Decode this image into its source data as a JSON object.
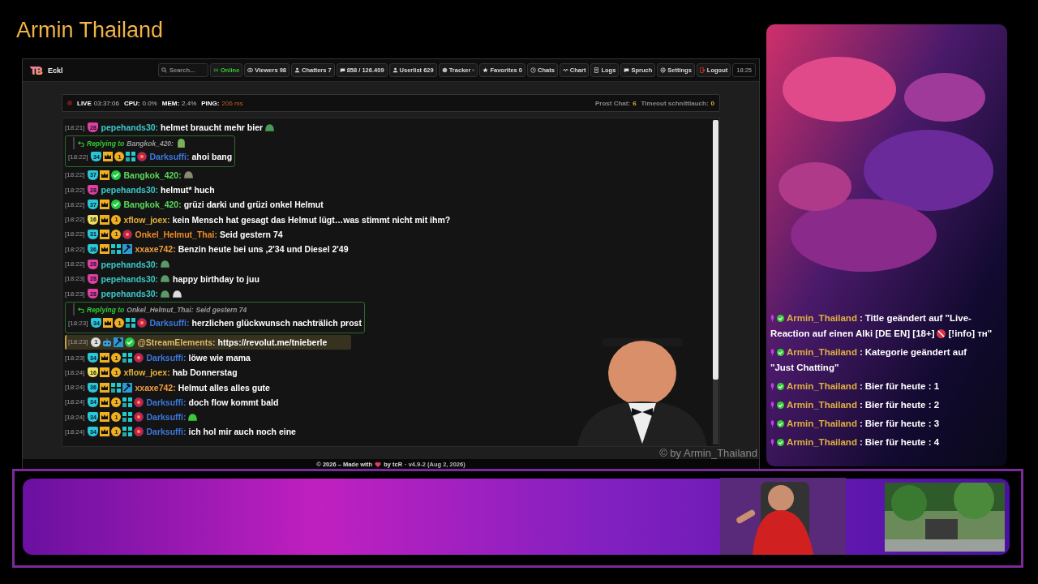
{
  "stream_title": "Armin Thailand",
  "app": {
    "logo": "TB",
    "channel": "Eckl",
    "search": {
      "placeholder": "Search..."
    },
    "nav": [
      {
        "kind": "online",
        "label": "Online"
      },
      {
        "kind": "viewers",
        "label": "Viewers 98"
      },
      {
        "kind": "chatters",
        "label": "Chatters 7"
      },
      {
        "kind": "messages",
        "label": "858 / 126.409"
      },
      {
        "kind": "userlist",
        "label": "Userlist 629"
      },
      {
        "kind": "tracker",
        "label": "Tracker"
      },
      {
        "kind": "favorites",
        "label": "Favorites 0"
      },
      {
        "kind": "chats",
        "label": "Chats"
      },
      {
        "kind": "chart",
        "label": "Chart"
      },
      {
        "kind": "logs",
        "label": "Logs"
      },
      {
        "kind": "spruch",
        "label": "Spruch"
      },
      {
        "kind": "settings",
        "label": "Settings"
      },
      {
        "kind": "logout",
        "label": "Logout"
      }
    ],
    "clock": "18:25",
    "status": {
      "live": "LIVE",
      "uptime": "03:37:06",
      "cpu_label": "CPU:",
      "cpu": "0.0%",
      "mem_label": "MEM:",
      "mem": "2.4%",
      "ping_label": "PING:",
      "ping": "206 ms",
      "prost_label": "Prost Chat:",
      "prost": "6",
      "timeout_label": "Timeout schnittlauch:",
      "timeout": "0"
    },
    "messages": [
      {
        "kind": "normal",
        "time": "[18:21]",
        "badges": [
          {
            "kind": "sub",
            "label": "28",
            "color": "#e040a0"
          }
        ],
        "user": "pepehands30:",
        "color": "#3cc8c8",
        "parts": [
          {
            "kind": "text",
            "text": "helmet braucht mehr bier"
          },
          {
            "kind": "emote",
            "color": "#4a9a5a"
          }
        ]
      },
      {
        "kind": "reply",
        "reply": {
          "label": "Replying to",
          "user": "Bangkok_420:",
          "parts": [
            {
              "kind": "emote",
              "color": "#7ab05a"
            }
          ]
        },
        "time": "[18:22]",
        "badges": [
          {
            "kind": "sub",
            "label": "34",
            "color": "#28c8d8"
          },
          {
            "kind": "crown"
          },
          {
            "kind": "coin",
            "label": "1"
          },
          {
            "kind": "grid"
          },
          {
            "kind": "globe"
          }
        ],
        "user": "Darksuffi:",
        "color": "#3b78dc",
        "parts": [
          {
            "kind": "text",
            "text": "ahoi bang"
          }
        ]
      },
      {
        "kind": "normal",
        "time": "[18:22]",
        "badges": [
          {
            "kind": "sub",
            "label": "37",
            "color": "#28c8d8"
          },
          {
            "kind": "crown"
          },
          {
            "kind": "verified"
          }
        ],
        "user": "Bangkok_420:",
        "color": "#5ad85a",
        "parts": [
          {
            "kind": "emote",
            "color": "#8a8a70"
          }
        ]
      },
      {
        "kind": "normal",
        "time": "[18:22]",
        "badges": [
          {
            "kind": "sub",
            "label": "28",
            "color": "#e040a0"
          }
        ],
        "user": "pepehands30:",
        "color": "#3cc8c8",
        "parts": [
          {
            "kind": "text",
            "text": "helmut* huch"
          }
        ]
      },
      {
        "kind": "normal",
        "time": "[18:22]",
        "badges": [
          {
            "kind": "sub",
            "label": "37",
            "color": "#28c8d8"
          },
          {
            "kind": "crown"
          },
          {
            "kind": "verified"
          }
        ],
        "user": "Bangkok_420:",
        "color": "#5ad85a",
        "parts": [
          {
            "kind": "text",
            "text": "grüzi darki und grüzi onkel Helmut"
          }
        ]
      },
      {
        "kind": "normal",
        "time": "[18:22]",
        "badges": [
          {
            "kind": "sub",
            "label": "16",
            "color": "#f0e060"
          },
          {
            "kind": "crown"
          },
          {
            "kind": "coin",
            "label": "1"
          }
        ],
        "user": "xflow_joex:",
        "color": "#e6b23a",
        "parts": [
          {
            "kind": "text",
            "text": "kein Mensch hat gesagt das Helmut lügt…was stimmt nicht mit ihm?"
          }
        ]
      },
      {
        "kind": "normal",
        "time": "[18:22]",
        "badges": [
          {
            "kind": "sub",
            "label": "31",
            "color": "#28c8d8"
          },
          {
            "kind": "crown"
          },
          {
            "kind": "coin",
            "label": "1"
          },
          {
            "kind": "globe"
          }
        ],
        "user": "Onkel_Helmut_Thai:",
        "color": "#f08c28",
        "parts": [
          {
            "kind": "text",
            "text": "Seid gestern 74"
          }
        ]
      },
      {
        "kind": "normal",
        "time": "[18:22]",
        "badges": [
          {
            "kind": "sub",
            "label": "36",
            "color": "#28c8d8"
          },
          {
            "kind": "crown"
          },
          {
            "kind": "grid"
          },
          {
            "kind": "hammer"
          }
        ],
        "user": "xxaxe742:",
        "color": "#f0a040",
        "parts": [
          {
            "kind": "text",
            "text": "Benzin heute bei uns ,2'34 und Diesel 2'49"
          }
        ]
      },
      {
        "kind": "normal",
        "time": "[18:22]",
        "badges": [
          {
            "kind": "sub",
            "label": "28",
            "color": "#e040a0"
          }
        ],
        "user": "pepehands30:",
        "color": "#3cc8c8",
        "parts": [
          {
            "kind": "emote",
            "color": "#5a9a6a"
          }
        ]
      },
      {
        "kind": "normal",
        "time": "[18:23]",
        "badges": [
          {
            "kind": "sub",
            "label": "28",
            "color": "#e040a0"
          }
        ],
        "user": "pepehands30:",
        "color": "#3cc8c8",
        "parts": [
          {
            "kind": "emote",
            "color": "#5a9a6a"
          },
          {
            "kind": "text",
            "text": "happy birthday to juu"
          }
        ]
      },
      {
        "kind": "normal",
        "time": "[18:23]",
        "badges": [
          {
            "kind": "sub",
            "label": "28",
            "color": "#e040a0"
          }
        ],
        "user": "pepehands30:",
        "color": "#3cc8c8",
        "parts": [
          {
            "kind": "emote",
            "color": "#5a9a6a"
          },
          {
            "kind": "emote",
            "color": "#dddddd"
          }
        ]
      },
      {
        "kind": "reply",
        "reply": {
          "label": "Replying to",
          "user": "Onkel_Helmut_Thai:",
          "parts": [
            {
              "kind": "text",
              "text": "Seid gestern 74"
            }
          ]
        },
        "time": "[18:23]",
        "badges": [
          {
            "kind": "sub",
            "label": "34",
            "color": "#28c8d8"
          },
          {
            "kind": "crown"
          },
          {
            "kind": "coin",
            "label": "1"
          },
          {
            "kind": "grid"
          },
          {
            "kind": "globe"
          }
        ],
        "user": "Darksuffi:",
        "color": "#3b78dc",
        "parts": [
          {
            "kind": "text",
            "text": "herzlichen glückwunsch nachträlich prost"
          }
        ]
      },
      {
        "kind": "highlight",
        "time": "[18:23]",
        "badges": [
          {
            "kind": "circle",
            "label": "1"
          },
          {
            "kind": "robot"
          },
          {
            "kind": "hammer"
          },
          {
            "kind": "verified"
          }
        ],
        "user": "@StreamElements:",
        "color": "#e0b868",
        "parts": [
          {
            "kind": "text",
            "text": "https://revolut.me/tnieberle"
          }
        ]
      },
      {
        "kind": "normal",
        "time": "[18:23]",
        "badges": [
          {
            "kind": "sub",
            "label": "34",
            "color": "#28c8d8"
          },
          {
            "kind": "crown"
          },
          {
            "kind": "coin",
            "label": "1"
          },
          {
            "kind": "grid"
          },
          {
            "kind": "globe"
          }
        ],
        "user": "Darksuffi:",
        "color": "#3b78dc",
        "parts": [
          {
            "kind": "text",
            "text": "löwe wie mama"
          }
        ]
      },
      {
        "kind": "normal",
        "time": "[18:24]",
        "badges": [
          {
            "kind": "sub",
            "label": "16",
            "color": "#f0e060"
          },
          {
            "kind": "crown"
          },
          {
            "kind": "coin",
            "label": "1"
          }
        ],
        "user": "xflow_joex:",
        "color": "#e6b23a",
        "parts": [
          {
            "kind": "text",
            "text": "hab Donnerstag"
          }
        ]
      },
      {
        "kind": "normal",
        "time": "[18:24]",
        "badges": [
          {
            "kind": "sub",
            "label": "36",
            "color": "#28c8d8"
          },
          {
            "kind": "crown"
          },
          {
            "kind": "grid"
          },
          {
            "kind": "hammer"
          }
        ],
        "user": "xxaxe742:",
        "color": "#f0a040",
        "parts": [
          {
            "kind": "text",
            "text": "Helmut alles alles gute"
          }
        ]
      },
      {
        "kind": "normal",
        "time": "[18:24]",
        "badges": [
          {
            "kind": "sub",
            "label": "34",
            "color": "#28c8d8"
          },
          {
            "kind": "crown"
          },
          {
            "kind": "coin",
            "label": "1"
          },
          {
            "kind": "grid"
          },
          {
            "kind": "globe"
          }
        ],
        "user": "Darksuffi:",
        "color": "#3b78dc",
        "parts": [
          {
            "kind": "text",
            "text": "doch flow kommt bald"
          }
        ]
      },
      {
        "kind": "normal",
        "time": "[18:24]",
        "badges": [
          {
            "kind": "sub",
            "label": "34",
            "color": "#28c8d8"
          },
          {
            "kind": "crown"
          },
          {
            "kind": "coin",
            "label": "1"
          },
          {
            "kind": "grid"
          },
          {
            "kind": "globe"
          }
        ],
        "user": "Darksuffi:",
        "color": "#3b78dc",
        "parts": [
          {
            "kind": "emote",
            "color": "#3cc83c"
          }
        ]
      },
      {
        "kind": "normal",
        "time": "[18:24]",
        "badges": [
          {
            "kind": "sub",
            "label": "34",
            "color": "#28c8d8"
          },
          {
            "kind": "crown"
          },
          {
            "kind": "coin",
            "label": "1"
          },
          {
            "kind": "grid"
          },
          {
            "kind": "globe"
          }
        ],
        "user": "Darksuffi:",
        "color": "#3b78dc",
        "parts": [
          {
            "kind": "text",
            "text": "ich hol mir auch noch eine"
          }
        ]
      }
    ],
    "watermark": "© by Armin_Thailand",
    "footer": {
      "made": "© 2026 – Made with",
      "by": "by tcR",
      "version": "· v4.9-2 (Aug 2, 2026)"
    }
  },
  "events": [
    {
      "user": "Armin_Thailand",
      "sep": ":",
      "parts": [
        {
          "kind": "text",
          "text": "Title geändert auf \"Live-"
        },
        {
          "kind": "text",
          "text": "Reaction auf einen Alki [DE EN] [18+]"
        },
        {
          "kind": "emote",
          "color": "#e03040"
        },
        {
          "kind": "text",
          "text": "[!info] ᴛʜ\""
        }
      ]
    },
    {
      "user": "Armin_Thailand",
      "sep": ":",
      "parts": [
        {
          "kind": "text",
          "text": "Kategorie geändert auf"
        },
        {
          "kind": "text",
          "text": "\"Just Chatting\""
        }
      ]
    },
    {
      "user": "Armin_Thailand",
      "sep": ":",
      "parts": [
        {
          "kind": "text",
          "text": "Bier für heute : 1"
        }
      ]
    },
    {
      "user": "Armin_Thailand",
      "sep": ":",
      "parts": [
        {
          "kind": "text",
          "text": "Bier für heute : 2"
        }
      ]
    },
    {
      "user": "Armin_Thailand",
      "sep": ":",
      "parts": [
        {
          "kind": "text",
          "text": "Bier für heute : 3"
        }
      ]
    },
    {
      "user": "Armin_Thailand",
      "sep": ":",
      "parts": [
        {
          "kind": "text",
          "text": "Bier für heute : 4"
        }
      ]
    }
  ]
}
